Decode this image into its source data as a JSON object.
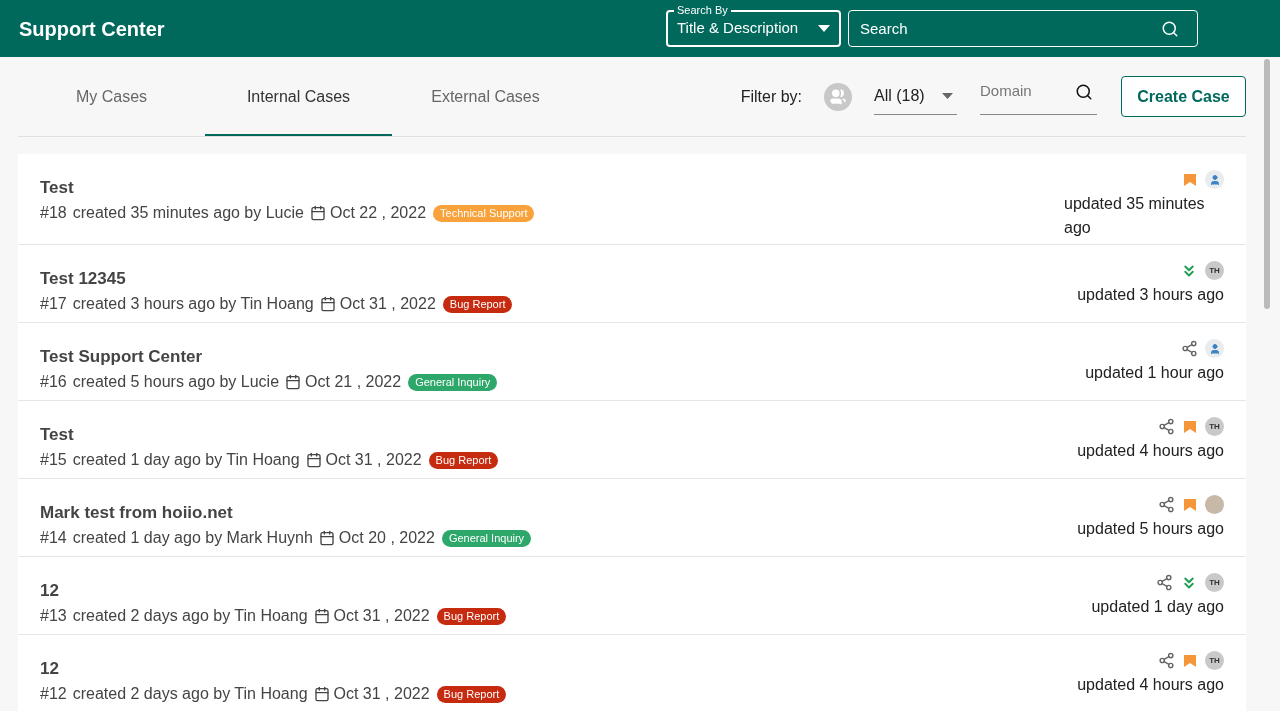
{
  "header": {
    "title": "Support Center",
    "search_by": {
      "label": "Search By",
      "value": "Title & Description"
    },
    "search": {
      "placeholder": "Search"
    }
  },
  "tabs": [
    {
      "label": "My Cases",
      "selected": false
    },
    {
      "label": "Internal Cases",
      "selected": true
    },
    {
      "label": "External Cases",
      "selected": false
    }
  ],
  "filter": {
    "label": "Filter by:",
    "select_value": "All (18)",
    "domain_placeholder": "Domain"
  },
  "create_button": "Create Case",
  "cases": [
    {
      "title": "Test",
      "number": "#18",
      "created": "created 35 minutes ago by Lucie",
      "date": "Oct 22 , 2022",
      "tag": {
        "label": "Technical Support",
        "color": "#f9a23c"
      },
      "shared": false,
      "priority": {
        "kind": "high"
      },
      "assignee": {
        "kind": "user"
      },
      "updated": "updated 35 minutes ago"
    },
    {
      "title": "Test 12345",
      "number": "#17",
      "created": "created 3 hours ago by Tin Hoang",
      "date": "Oct 31 , 2022",
      "tag": {
        "label": "Bug Report",
        "color": "#c62a0f"
      },
      "shared": false,
      "priority": {
        "kind": "low"
      },
      "assignee": {
        "kind": "initials",
        "initials": "TH"
      },
      "updated": "updated 3 hours ago"
    },
    {
      "title": "Test Support Center",
      "number": "#16",
      "created": "created 5 hours ago by Lucie",
      "date": "Oct 21 , 2022",
      "tag": {
        "label": "General Inquiry",
        "color": "#2ea86a"
      },
      "shared": true,
      "assignee": {
        "kind": "user"
      },
      "updated": "updated 1 hour ago"
    },
    {
      "title": "Test",
      "number": "#15",
      "created": "created 1 day ago by Tin Hoang",
      "date": "Oct 31 , 2022",
      "tag": {
        "label": "Bug Report",
        "color": "#c62a0f"
      },
      "shared": true,
      "priority": {
        "kind": "high"
      },
      "assignee": {
        "kind": "initials",
        "initials": "TH"
      },
      "updated": "updated 4 hours ago"
    },
    {
      "title": "Mark test from hoiio.net",
      "number": "#14",
      "created": "created 1 day ago by Mark Huynh",
      "date": "Oct 20 , 2022",
      "tag": {
        "label": "General Inquiry",
        "color": "#2ea86a"
      },
      "shared": true,
      "priority": {
        "kind": "high"
      },
      "assignee": {
        "kind": "photo"
      },
      "updated": "updated 5 hours ago"
    },
    {
      "title": "12",
      "number": "#13",
      "created": "created 2 days ago by Tin Hoang",
      "date": "Oct 31 , 2022",
      "tag": {
        "label": "Bug Report",
        "color": "#c62a0f"
      },
      "shared": true,
      "priority": {
        "kind": "low"
      },
      "assignee": {
        "kind": "initials",
        "initials": "TH"
      },
      "updated": "updated 1 day ago"
    },
    {
      "title": "12",
      "number": "#12",
      "created": "created 2 days ago by Tin Hoang",
      "date": "Oct 31 , 2022",
      "tag": {
        "label": "Bug Report",
        "color": "#c62a0f"
      },
      "shared": true,
      "priority": {
        "kind": "high"
      },
      "assignee": {
        "kind": "initials",
        "initials": "TH"
      },
      "updated": "updated 4 hours ago"
    }
  ]
}
